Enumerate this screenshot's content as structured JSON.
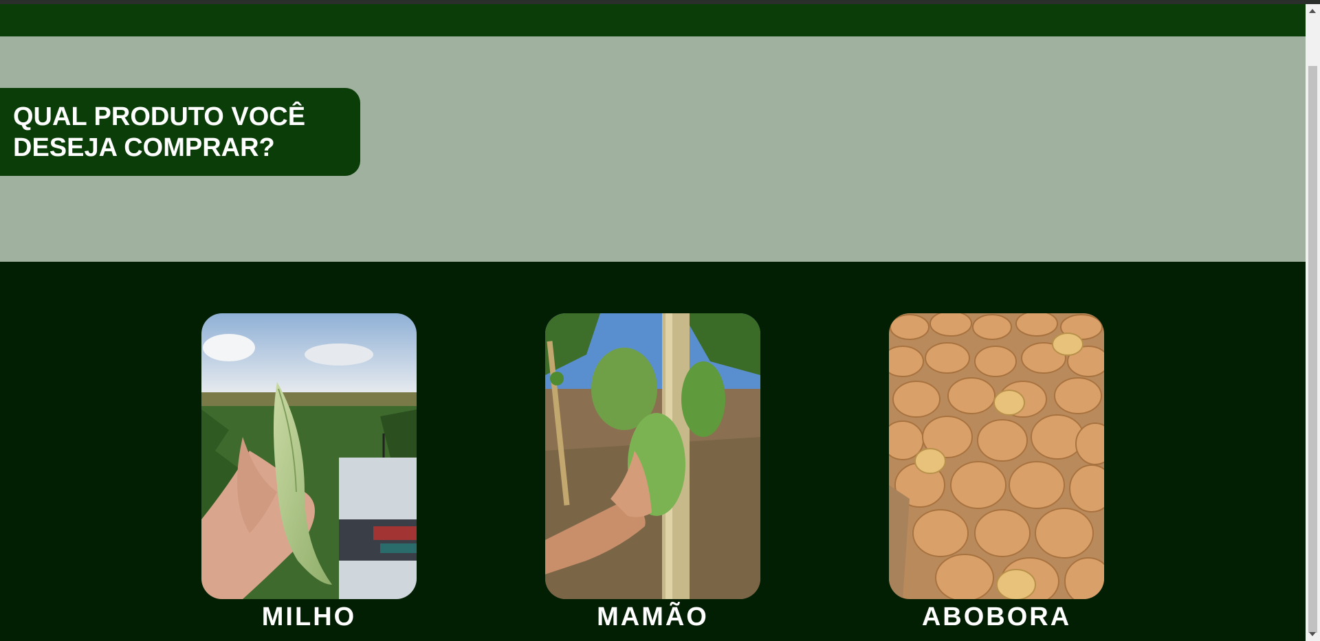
{
  "hero": {
    "title_line1": "QUAL PRODUTO VOCÊ",
    "title_line2": "DESEJA COMPRAR?"
  },
  "products": [
    {
      "label": "MILHO",
      "image": "corn-photo"
    },
    {
      "label": "MAMÃO",
      "image": "papaya-photo"
    },
    {
      "label": "ABOBORA",
      "image": "pumpkin-photo"
    }
  ],
  "colors": {
    "topbar": "#0a3d07",
    "hero_bg": "#a1b19f",
    "products_bg": "#031f03",
    "text": "#ffffff"
  }
}
